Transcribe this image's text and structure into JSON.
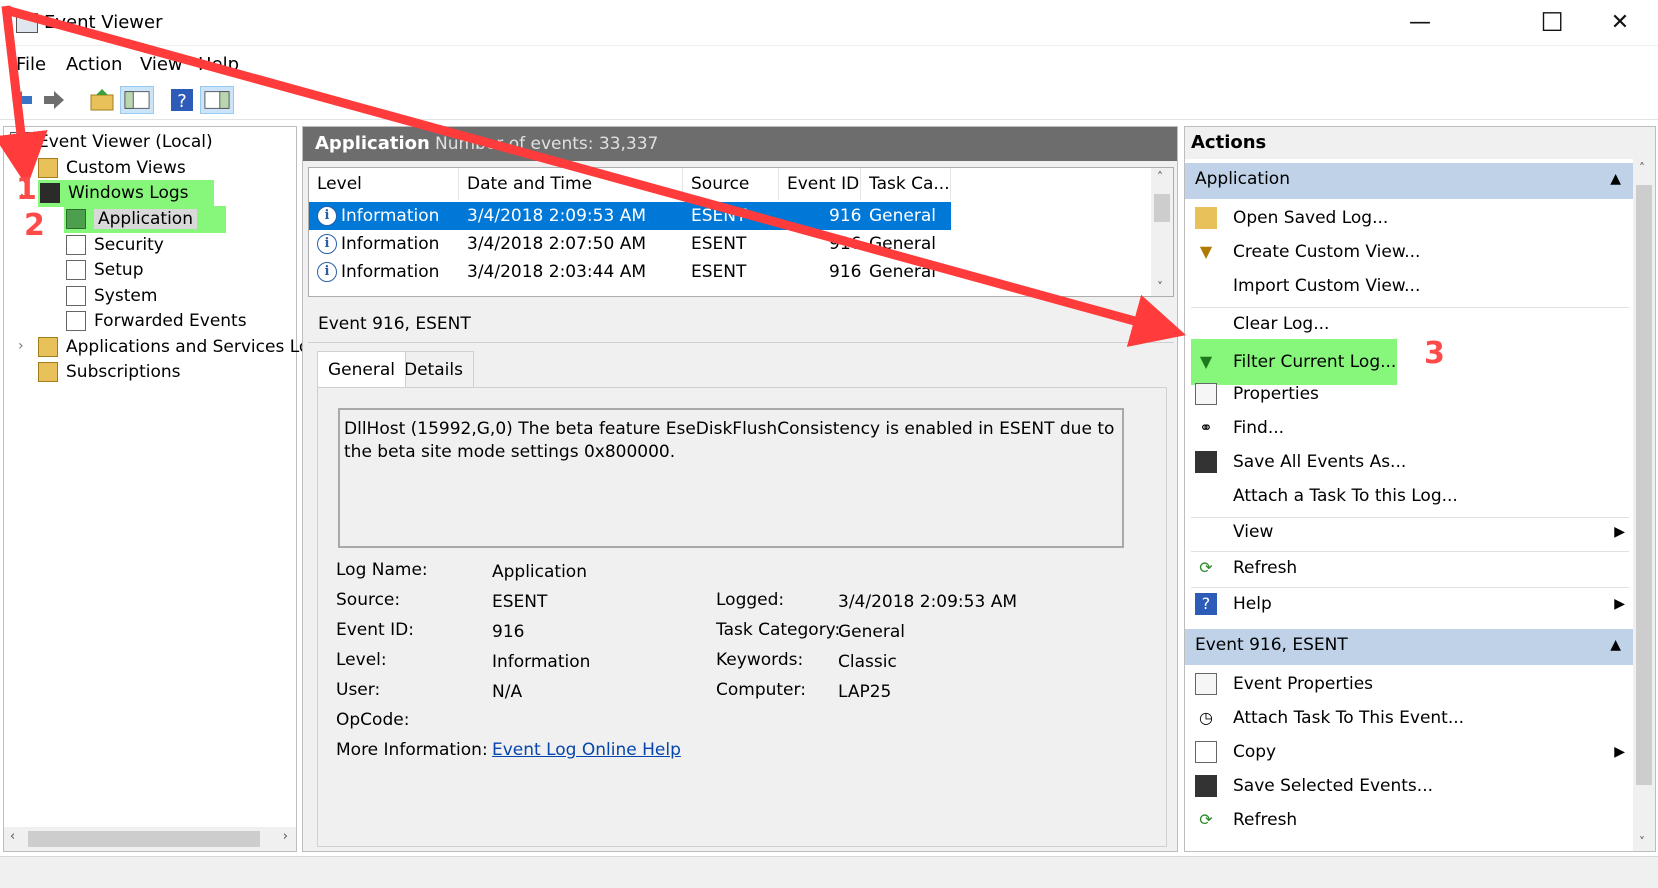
{
  "window": {
    "title": "Event Viewer",
    "minimize": "—",
    "maximize": "☐",
    "close": "✕"
  },
  "menu": [
    "File",
    "Action",
    "View",
    "Help"
  ],
  "tree": {
    "root": "Event Viewer (Local)",
    "custom_views": "Custom Views",
    "windows_logs": "Windows Logs",
    "logs": [
      "Application",
      "Security",
      "Setup",
      "System",
      "Forwarded Events"
    ],
    "apps_services": "Applications and Services Log",
    "subscriptions": "Subscriptions"
  },
  "log_header": {
    "name": "Application",
    "count_text": "Number of events: 33,337"
  },
  "grid": {
    "columns": [
      "Level",
      "Date and Time",
      "Source",
      "Event ID",
      "Task Ca..."
    ],
    "rows": [
      {
        "level": "Information",
        "datetime": "3/4/2018 2:09:53 AM",
        "source": "ESENT",
        "event_id": "916",
        "task": "General"
      },
      {
        "level": "Information",
        "datetime": "3/4/2018 2:07:50 AM",
        "source": "ESENT",
        "event_id": "916",
        "task": "General"
      },
      {
        "level": "Information",
        "datetime": "3/4/2018 2:03:44 AM",
        "source": "ESENT",
        "event_id": "916",
        "task": "General"
      }
    ]
  },
  "detail": {
    "title": "Event 916, ESENT",
    "tabs": [
      "General",
      "Details"
    ],
    "description": "DllHost (15992,G,0) The beta feature EseDiskFlushConsistency is enabled in ESENT due to the beta site mode settings 0x800000.",
    "labels": {
      "log_name": "Log Name:",
      "source": "Source:",
      "event_id": "Event ID:",
      "level": "Level:",
      "user": "User:",
      "opcode": "OpCode:",
      "more_info": "More Information:",
      "logged": "Logged:",
      "task_category": "Task Category:",
      "keywords": "Keywords:",
      "computer": "Computer:"
    },
    "values": {
      "log_name": "Application",
      "source": "ESENT",
      "event_id": "916",
      "level": "Information",
      "user": "N/A",
      "more_info_link": "Event Log Online Help",
      "logged": "3/4/2018 2:09:53 AM",
      "task_category": "General",
      "keywords": "Classic",
      "computer": "LAP25"
    }
  },
  "actions": {
    "header": "Actions",
    "section1": "Application",
    "section1_items": [
      "Open Saved Log...",
      "Create Custom View...",
      "Import Custom View...",
      "Clear Log...",
      "Filter Current Log...",
      "Properties",
      "Find...",
      "Save All Events As...",
      "Attach a Task To this Log...",
      "View",
      "Refresh",
      "Help"
    ],
    "section2": "Event 916, ESENT",
    "section2_items": [
      "Event Properties",
      "Attach Task To This Event...",
      "Copy",
      "Save Selected Events...",
      "Refresh"
    ]
  },
  "annotations": {
    "step1": "1",
    "step2": "2",
    "step3": "3"
  },
  "colors": {
    "selection": "#0078d7",
    "highlight": "#86f77a",
    "arrow": "#ff3b3b",
    "section": "#bfd2e8"
  }
}
